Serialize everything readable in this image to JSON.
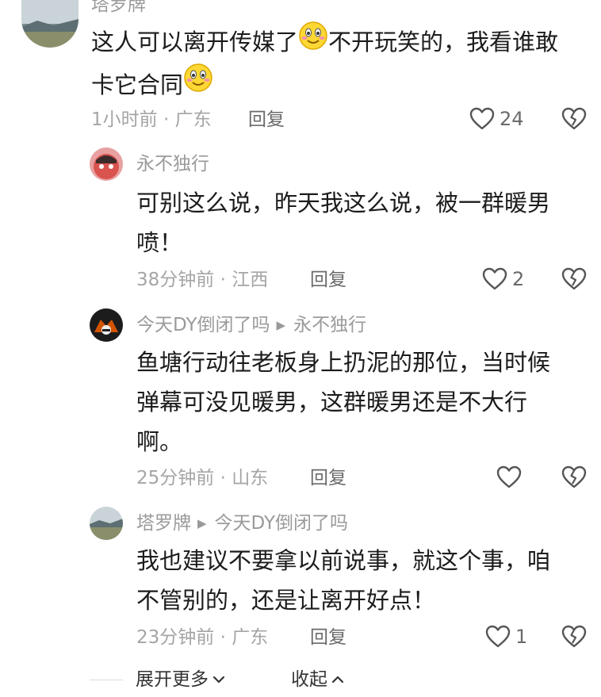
{
  "comments": [
    {
      "user": "塔罗牌",
      "text_line1": "这人可以离开传媒了",
      "text_line1b": "不开玩笑的，我看谁敢",
      "text_line2": "卡它合同",
      "time_loc": "1小时前 · 广东",
      "reply_label": "回复",
      "likes": "24"
    },
    {
      "user": "永不独行",
      "text_line1": "可别这么说，昨天我这么说，被一群暖男",
      "text_line2": "喷！",
      "time_loc": "38分钟前 · 江西",
      "reply_label": "回复",
      "likes": "2"
    },
    {
      "user": "今天DY倒闭了吗",
      "reply_to": "永不独行",
      "text_line1": "鱼塘行动往老板身上扔泥的那位，当时候",
      "text_line2": "弹幕可没见暖男，这群暖男还是不大行",
      "text_line3": "啊。",
      "time_loc": "25分钟前 · 山东",
      "reply_label": "回复",
      "likes": ""
    },
    {
      "user": "塔罗牌",
      "reply_to": "今天DY倒闭了吗",
      "text_line1": "我也建议不要拿以前说事，就这个事，咱",
      "text_line2": "不管别的，还是让离开好点！",
      "time_loc": "23分钟前 · 广东",
      "reply_label": "回复",
      "likes": "1"
    }
  ],
  "footer": {
    "expand_label": "展开更多",
    "collapse_label": "收起"
  },
  "icons": {
    "like": "heart-outline-icon",
    "dislike": "broken-heart-icon",
    "reply_arrow": "triangle-right-icon",
    "emoji": "smiling-face-emoji",
    "expand": "chevron-down-icon",
    "collapse": "chevron-up-icon"
  }
}
